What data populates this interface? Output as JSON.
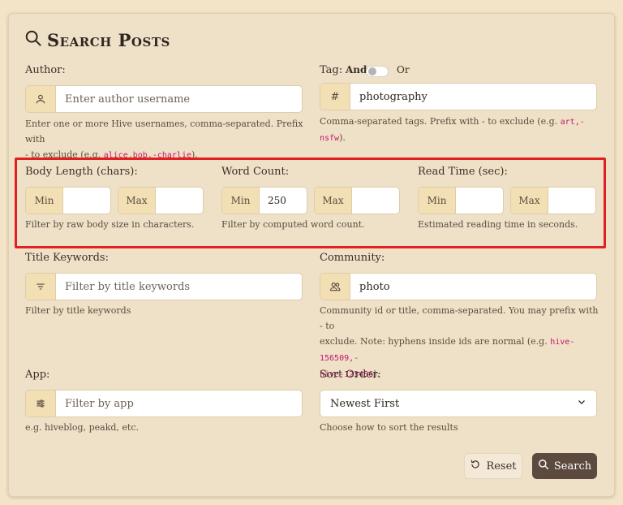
{
  "title": "Search Posts",
  "author": {
    "label": "Author:",
    "placeholder": "Enter author username",
    "help_prefix": "Enter one or more Hive usernames, comma-separated. Prefix with",
    "help_line2_a": "- to exclude (e.g.",
    "help_code": "alice,bob,-charlie",
    "help_end": ")."
  },
  "tag": {
    "label": "Tag:",
    "and_label": "And",
    "or_label": "Or",
    "prefix_symbol": "#",
    "value": "photography",
    "help_a": "Comma-separated tags. Prefix with - to exclude (e.g.",
    "help_code": "art,-nsfw",
    "help_end": ")."
  },
  "body_length": {
    "label": "Body Length (chars):",
    "min_label": "Min",
    "max_label": "Max",
    "min_value": "",
    "max_value": "",
    "help": "Filter by raw body size in characters."
  },
  "word_count": {
    "label": "Word Count:",
    "min_label": "Min",
    "max_label": "Max",
    "min_value": "250",
    "max_value": "",
    "help": "Filter by computed word count."
  },
  "read_time": {
    "label": "Read Time (sec):",
    "min_label": "Min",
    "max_label": "Max",
    "min_value": "",
    "max_value": "",
    "help": "Estimated reading time in seconds."
  },
  "title_keywords": {
    "label": "Title Keywords:",
    "placeholder": "Filter by title keywords",
    "help": "Filter by title keywords"
  },
  "community": {
    "label": "Community:",
    "value": "photo",
    "help_line1": "Community id or title, comma-separated. You may prefix with - to",
    "help_line2": "exclude. Note: hyphens inside ids are normal (e.g.",
    "help_code1": "hive-156509,-",
    "help_code2": "hive-123456",
    "help_end": ")."
  },
  "app": {
    "label": "App:",
    "placeholder": "Filter by app",
    "help": "e.g. hiveblog, peakd, etc."
  },
  "sort": {
    "label": "Sort Order:",
    "selected": "Newest First",
    "help": "Choose how to sort the results"
  },
  "buttons": {
    "reset": "Reset",
    "search": "Search"
  },
  "icons": {
    "title": "search-icon",
    "author": "user-icon",
    "tag": "hash-icon",
    "title_keywords": "filter-lines-icon",
    "community": "users-icon",
    "app": "sliders-icon",
    "sort": "chevron-down-icon",
    "reset": "reset-icon",
    "search": "search-icon"
  },
  "colors": {
    "background": "#f3e4c7",
    "card": "#efe0c8",
    "prefix": "#f2dfb4",
    "search_button": "#5c4a3f",
    "highlight_box": "#e32020",
    "code": "#c2186b"
  }
}
